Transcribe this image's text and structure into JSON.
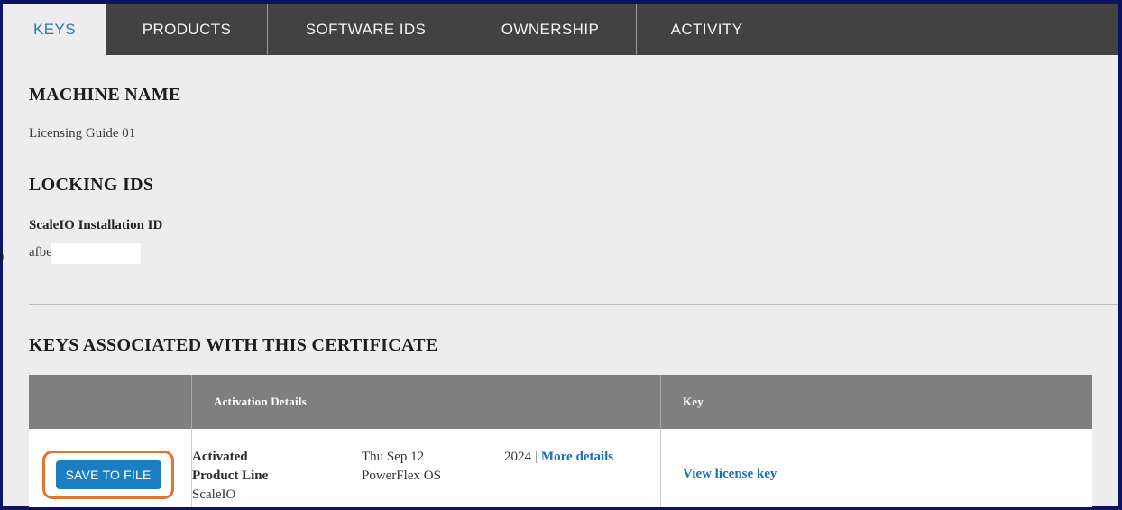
{
  "theme": {
    "border_navy": "#0d1363",
    "page_bg": "#eeedee",
    "tab_bar_bg": "#424242",
    "tab_text": "#f4f4f4",
    "active_tab_text": "#2878b8",
    "table_header_bg": "#7f7f7f",
    "button_blue": "#1b7ec2",
    "highlight_orange": "#e2752e",
    "link_blue": "#1a70b8"
  },
  "tabs": [
    {
      "label": "KEYS",
      "active": true
    },
    {
      "label": "PRODUCTS",
      "active": false
    },
    {
      "label": "SOFTWARE IDS",
      "active": false
    },
    {
      "label": "OWNERSHIP",
      "active": false
    },
    {
      "label": "ACTIVITY",
      "active": false
    }
  ],
  "machine": {
    "heading": "MACHINE NAME",
    "value": "Licensing Guide 01"
  },
  "locking": {
    "heading": "LOCKING IDS",
    "id_label": "ScaleIO Installation ID",
    "id_value_visible": "afbe",
    "edge_artifact": ")"
  },
  "keys_section": {
    "heading": "KEYS ASSOCIATED WITH THIS CERTIFICATE",
    "table": {
      "headers": {
        "activation": "Activation Details",
        "key": "Key"
      },
      "row": {
        "save_button": "SAVE TO FILE",
        "labels": [
          "Activated",
          "Product Line",
          "ScaleIO"
        ],
        "values": [
          "Thu Sep 12",
          "PowerFlex OS"
        ],
        "year": "2024",
        "separator": "|",
        "more_details": "More details",
        "view_key": "View license key"
      }
    }
  }
}
